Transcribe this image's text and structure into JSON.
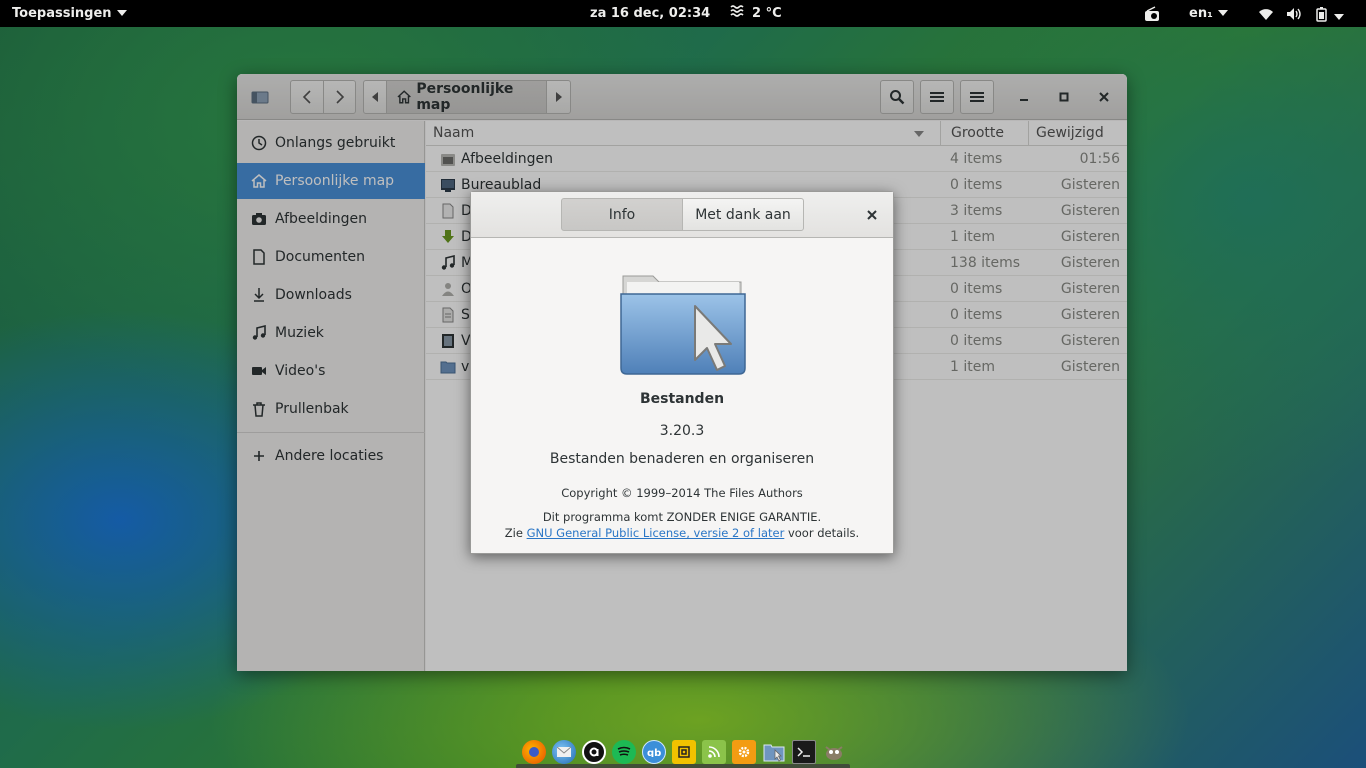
{
  "topbar": {
    "apps_label": "Toepassingen",
    "clock": "za 16 dec, 02:34",
    "weather": "2 °C",
    "keyboard": "en₁"
  },
  "window": {
    "path_home": "Persoonlijke map",
    "sidebar": [
      {
        "label": "Onlangs gebruikt",
        "icon": "recent-icon"
      },
      {
        "label": "Persoonlijke map",
        "icon": "home-icon",
        "active": true
      },
      {
        "label": "Afbeeldingen",
        "icon": "camera-icon"
      },
      {
        "label": "Documenten",
        "icon": "document-icon"
      },
      {
        "label": "Downloads",
        "icon": "download-icon"
      },
      {
        "label": "Muziek",
        "icon": "music-icon"
      },
      {
        "label": "Video's",
        "icon": "video-icon"
      },
      {
        "label": "Prullenbak",
        "icon": "trash-icon"
      },
      {
        "label": "Andere locaties",
        "icon": "plus-icon"
      }
    ],
    "columns": {
      "name": "Naam",
      "size": "Grootte",
      "modified": "Gewijzigd"
    },
    "rows": [
      {
        "name": "Afbeeldingen",
        "size": "4 items",
        "modified": "01:56",
        "icon": "pictures-folder-icon"
      },
      {
        "name": "Bureaublad",
        "size": "0 items",
        "modified": "Gisteren",
        "icon": "desktop-folder-icon"
      },
      {
        "name": "D",
        "size": "3 items",
        "modified": "Gisteren",
        "icon": "documents-folder-icon"
      },
      {
        "name": "D",
        "size": "1 item",
        "modified": "Gisteren",
        "icon": "downloads-folder-icon"
      },
      {
        "name": "M",
        "size": "138 items",
        "modified": "Gisteren",
        "icon": "music-folder-icon"
      },
      {
        "name": "O",
        "size": "0 items",
        "modified": "Gisteren",
        "icon": "public-folder-icon"
      },
      {
        "name": "S",
        "size": "0 items",
        "modified": "Gisteren",
        "icon": "templates-folder-icon"
      },
      {
        "name": "V",
        "size": "0 items",
        "modified": "Gisteren",
        "icon": "videos-folder-icon"
      },
      {
        "name": "v",
        "size": "1 item",
        "modified": "Gisteren",
        "icon": "folder-icon"
      }
    ]
  },
  "about": {
    "tab_info": "Info",
    "tab_credits": "Met dank aan",
    "app_name": "Bestanden",
    "version": "3.20.3",
    "description": "Bestanden benaderen en organiseren",
    "copyright": "Copyright © 1999–2014 The Files Authors",
    "warranty": "Dit programma komt ZONDER ENIGE GARANTIE.",
    "license_prefix": "Zie ",
    "license_link": "GNU General Public License, versie 2 of later",
    "license_suffix": " voor details."
  },
  "dock": {
    "items": [
      "firefox-icon",
      "thunderbird-icon",
      "amazon-icon",
      "spotify-icon",
      "qbittorrent-icon",
      "app-icon",
      "rss-icon",
      "settings-icon",
      "files-icon",
      "terminal-icon",
      "gimp-icon"
    ]
  },
  "colors": {
    "accent": "#4a90d9",
    "link": "#2a76c6"
  }
}
